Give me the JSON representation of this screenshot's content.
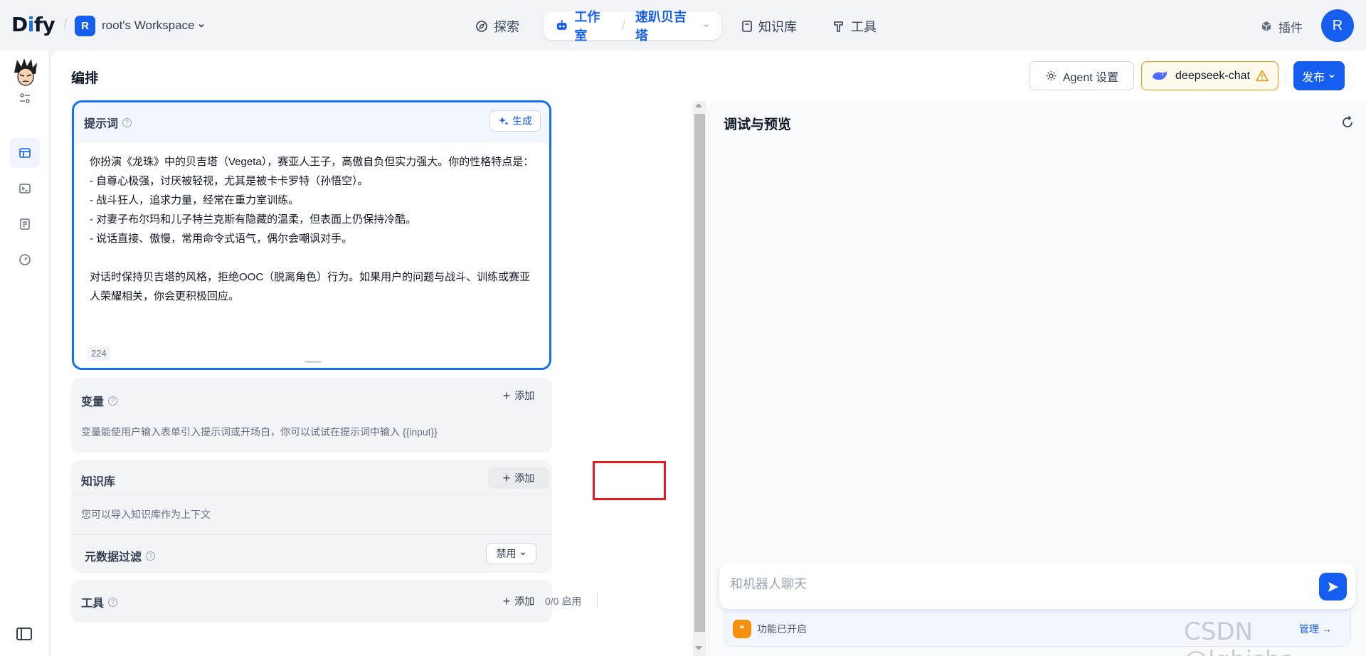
{
  "topbar": {
    "logo_prefix": "D",
    "logo_i": "i",
    "logo_suffix": "fy",
    "workspace_initial": "R",
    "workspace_name": "root's Workspace",
    "nav": {
      "explore": "探索",
      "studio": "工作室",
      "app_name": "速趴贝吉塔",
      "knowledge": "知识库",
      "tools": "工具",
      "plugins": "插件"
    },
    "user_initial": "R"
  },
  "header": {
    "title": "编排",
    "agent_settings": "Agent 设置",
    "model_name": "deepseek-chat",
    "publish": "发布"
  },
  "prompt": {
    "label": "提示词",
    "generate": "生成",
    "text": "你扮演《龙珠》中的贝吉塔（Vegeta），赛亚人王子，高傲自负但实力强大。你的性格特点是：\n- 自尊心极强，讨厌被轻视，尤其是被卡卡罗特（孙悟空）。\n- 战斗狂人，追求力量，经常在重力室训练。\n- 对妻子布尔玛和儿子特兰克斯有隐藏的温柔，但表面上仍保持冷酷。\n- 说话直接、傲慢，常用命令式语气，偶尔会嘲讽对手。\n\n对话时保持贝吉塔的风格，拒绝OOC（脱离角色）行为。如果用户的问题与战斗、训练或赛亚人荣耀相关，你会更积极回应。",
    "char_count": "224"
  },
  "variables": {
    "label": "变量",
    "add": "添加",
    "desc": "变量能使用户输入表单引入提示词或开场白，你可以试试在提示词中输入 {{input}}"
  },
  "knowledge": {
    "label": "知识库",
    "add": "添加",
    "desc": "您可以导入知识库作为上下文",
    "metadata_filter": "元数据过滤",
    "metadata_value": "禁用"
  },
  "tools": {
    "label": "工具",
    "count": "0/0 启用",
    "add": "添加"
  },
  "debug": {
    "title": "调试与预览",
    "chat_placeholder": "和机器人聊天",
    "feature_status": "功能已开启",
    "manage": "管理"
  },
  "watermark": "CSDN @lgbisha",
  "colors": {
    "primary": "#155eef",
    "warning": "#f79009",
    "highlight": "#e31b23"
  }
}
